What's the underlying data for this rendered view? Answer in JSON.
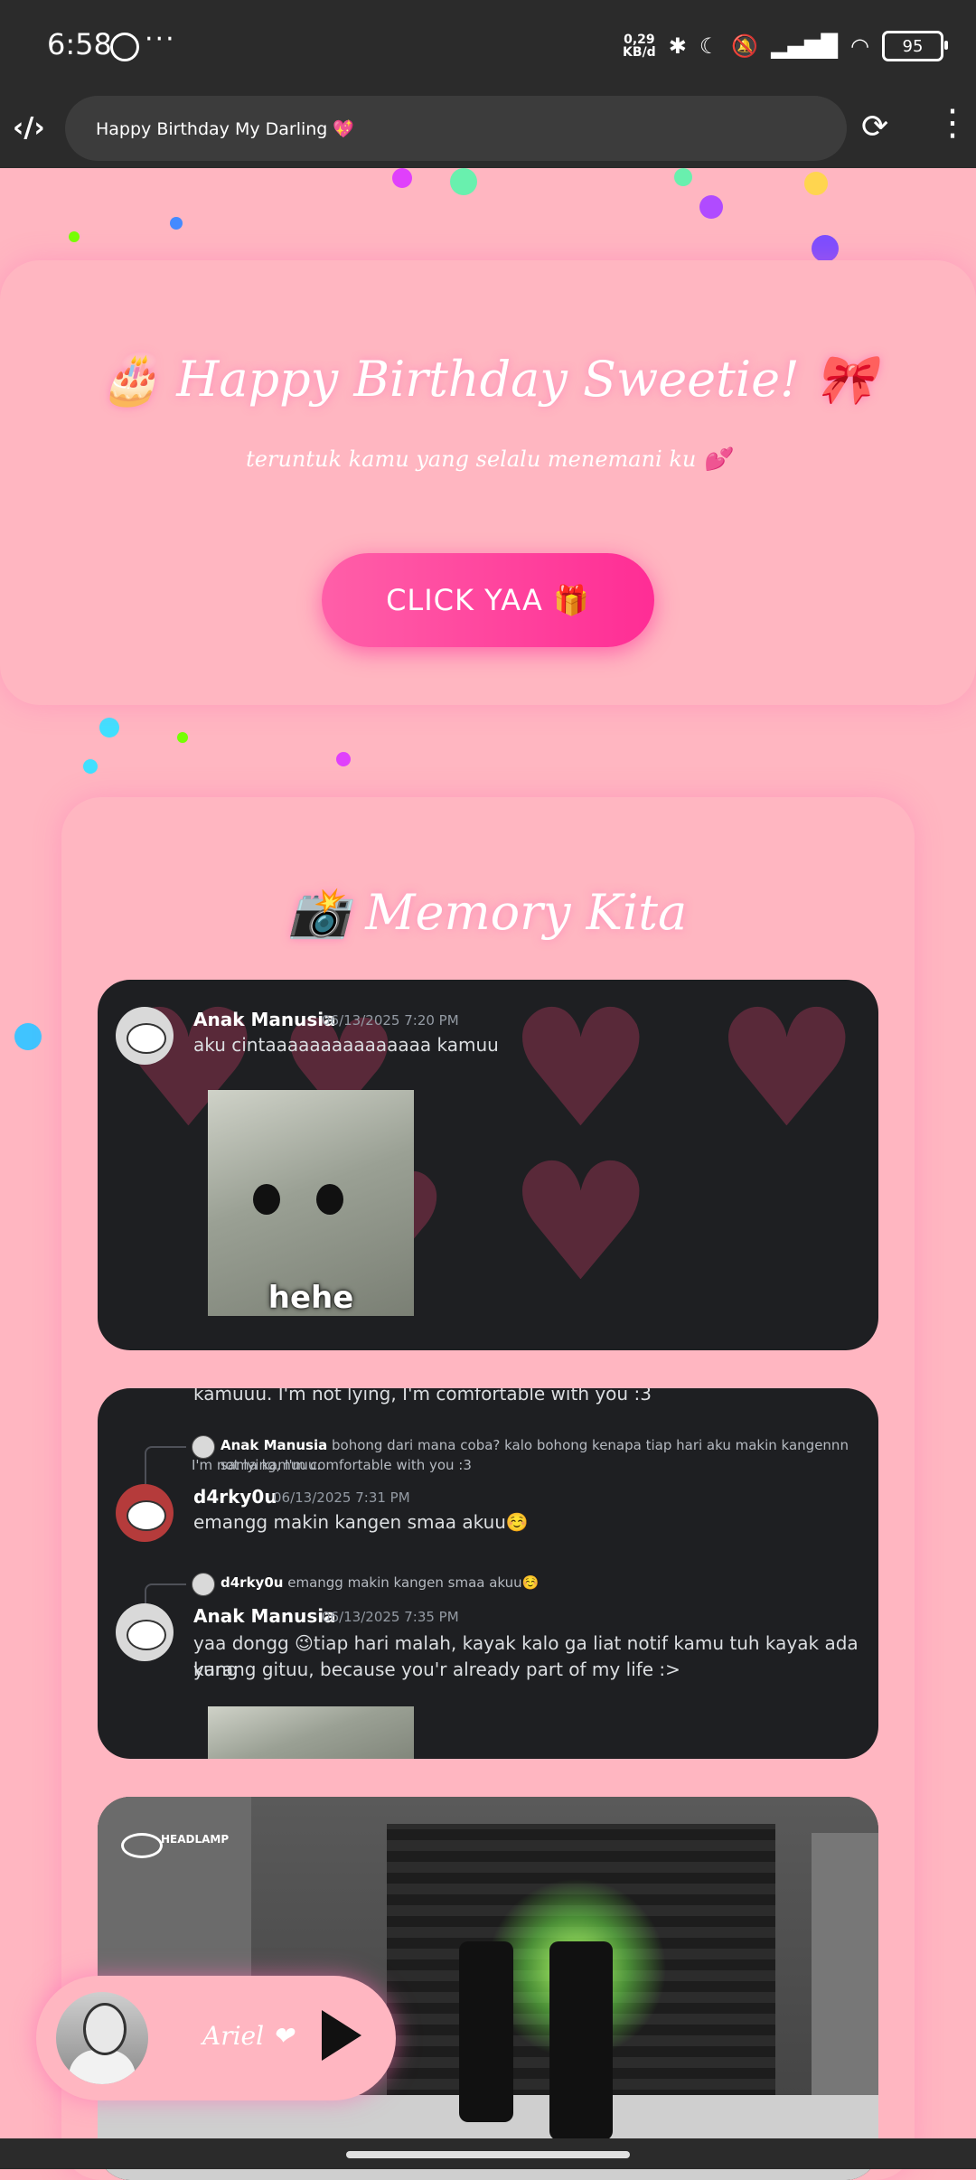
{
  "status_bar": {
    "time": "6:58",
    "net_speed_value": "0,29",
    "net_speed_unit": "KB/d",
    "battery": "95"
  },
  "browser": {
    "url_title": "Happy Birthday My Darling 💖"
  },
  "hero": {
    "title": "🎂 Happy Birthday Sweetie! 🎀",
    "subtitle": "teruntuk kamu yang selalu menemani ku 💕",
    "button_label": "CLICK YAA 🎁"
  },
  "memory": {
    "title": "📸 Memory Kita",
    "card1": {
      "username": "Anak Manusia",
      "timestamp": "06/13/2025 7:20 PM",
      "message": "aku cintaaaaaaaaaaaaaaa kamuu",
      "image_caption": "hehe"
    },
    "card2": {
      "cutoff_text": "kamuuu. I'm not lying, I'm comfortable with you :3",
      "reply1_user": "Anak Manusia",
      "reply1_text": "bohong dari mana coba? kalo bohong kenapa tiap hari aku makin kangennn sama kamuuu.",
      "reply1_text2": "I'm not lying, I'm comfortable with you :3",
      "msg1_user": "d4rky0u",
      "msg1_time": "06/13/2025 7:31 PM",
      "msg1_text": "emangg makin kangen smaa akuu☺️",
      "reply2_user": "d4rky0u",
      "reply2_text": "emangg makin kangen smaa akuu☺️",
      "msg2_user": "Anak Manusia",
      "msg2_time": "06/13/2025 7:35 PM",
      "msg2_text": "yaa dongg 😉tiap hari malah, kayak kalo ga liat notif kamu tuh kayak ada yang",
      "msg2_text2": "kurang gituu, because you'r already part of my life :>"
    },
    "card3": {
      "watermark": "HEADLAMP"
    }
  },
  "player": {
    "name": "Ariel ❤"
  },
  "icons": [
    "whatsapp-icon",
    "bluetooth-icon",
    "moon-icon",
    "mute-icon",
    "signal-icon",
    "wifi-icon",
    "battery-icon",
    "app-logo-icon",
    "reload-icon",
    "kebab-menu-icon",
    "play-icon"
  ],
  "colors": {
    "background": "#ffb6c1",
    "button_gradient_start": "#ff5fa8",
    "button_gradient_end": "#ff2d95",
    "chat_background": "#1e1f22"
  }
}
